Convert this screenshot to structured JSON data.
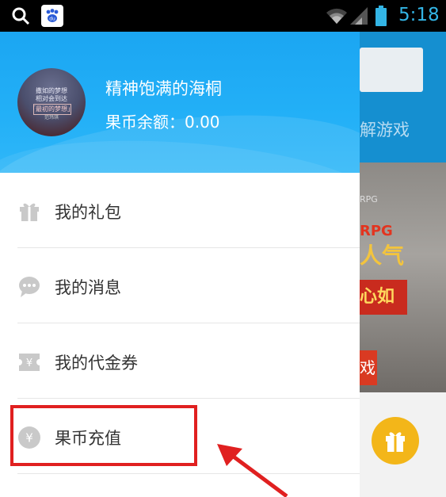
{
  "status_bar": {
    "time": "5:18",
    "icons": [
      "search-icon",
      "baidu-icon",
      "wifi-icon",
      "signal-icon",
      "battery-icon"
    ],
    "color": "#33b5e5"
  },
  "drawer": {
    "header": {
      "user_name": "精神饱满的海桐",
      "balance": "果币余额：0.00",
      "avatar_lines": [
        "撒如的梦想",
        "相对会到达",
        "「最初的梦想」",
        "范玮琪"
      ],
      "color": "#1ba6f2"
    },
    "menu": [
      {
        "label": "我的礼包",
        "icon": "gift-icon"
      },
      {
        "label": "我的消息",
        "icon": "message-icon"
      },
      {
        "label": "我的代金券",
        "icon": "voucher-icon"
      },
      {
        "label": "果币充值",
        "icon": "yuan-coin-icon"
      }
    ]
  },
  "background_app": {
    "tab_text": "解游戏",
    "banner_texts": [
      "RPG",
      "RPG",
      "人气",
      "心如",
      "戏"
    ],
    "fab_icon": "gift-icon",
    "header_color": "#158fd0",
    "fab_color": "#f3b619"
  },
  "annotation": {
    "highlight_color": "#e02020",
    "arrow_color": "#e02020"
  }
}
